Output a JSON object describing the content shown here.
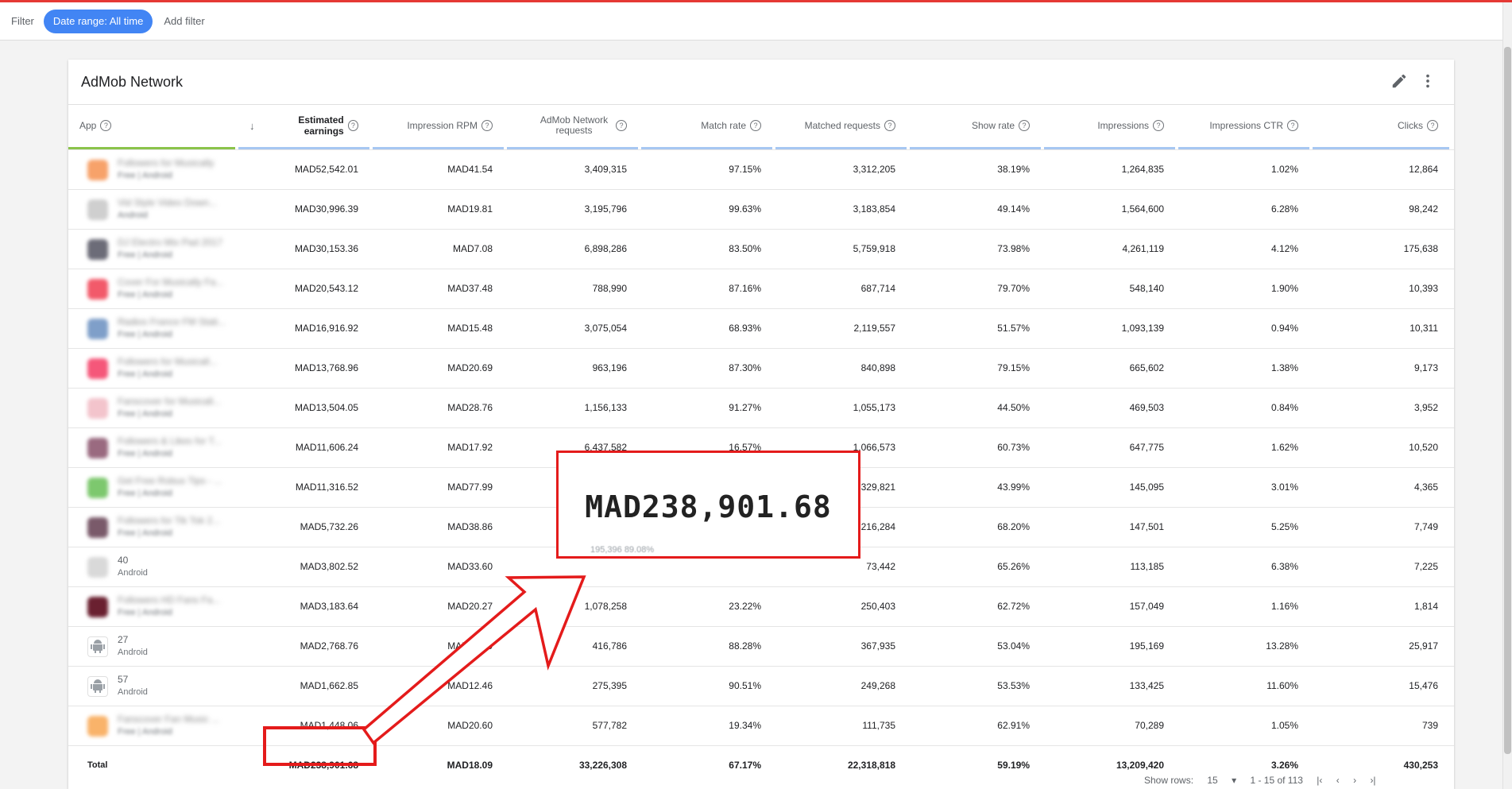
{
  "filterbar": {
    "filter_label": "Filter",
    "date_chip": "Date range: All time",
    "add_filter": "Add filter"
  },
  "card": {
    "title": "AdMob Network"
  },
  "columns": [
    {
      "label": "App",
      "help": true,
      "bold": false,
      "sorted": false
    },
    {
      "label": "Estimated earnings",
      "help": true,
      "bold": true,
      "sorted": true
    },
    {
      "label": "Impression RPM",
      "help": true,
      "bold": false,
      "sorted": false
    },
    {
      "label": "AdMob Network requests",
      "help": true,
      "bold": false,
      "sorted": false
    },
    {
      "label": "Match rate",
      "help": true,
      "bold": false,
      "sorted": false
    },
    {
      "label": "Matched requests",
      "help": true,
      "bold": false,
      "sorted": false
    },
    {
      "label": "Show rate",
      "help": true,
      "bold": false,
      "sorted": false
    },
    {
      "label": "Impressions",
      "help": true,
      "bold": false,
      "sorted": false
    },
    {
      "label": "Impressions CTR",
      "help": true,
      "bold": false,
      "sorted": false
    },
    {
      "label": "Clicks",
      "help": true,
      "bold": false,
      "sorted": false
    }
  ],
  "rows": [
    {
      "app_name": "Followers for Musically",
      "app_sub": "Free | Android",
      "blur": true,
      "icon_color": "#f7a26a",
      "android": false,
      "values": [
        "MAD52,542.01",
        "MAD41.54",
        "3,409,315",
        "97.15%",
        "3,312,205",
        "38.19%",
        "1,264,835",
        "1.02%",
        "12,864"
      ]
    },
    {
      "app_name": "Vid Style Video Down...",
      "app_sub": "Android",
      "blur": true,
      "icon_color": "#cfcfcf",
      "android": false,
      "values": [
        "MAD30,996.39",
        "MAD19.81",
        "3,195,796",
        "99.63%",
        "3,183,854",
        "49.14%",
        "1,564,600",
        "6.28%",
        "98,242"
      ]
    },
    {
      "app_name": "DJ Electro Mix Pad 2017",
      "app_sub": "Free | Android",
      "blur": true,
      "icon_color": "#6c6c78",
      "android": false,
      "values": [
        "MAD30,153.36",
        "MAD7.08",
        "6,898,286",
        "83.50%",
        "5,759,918",
        "73.98%",
        "4,261,119",
        "4.12%",
        "175,638"
      ]
    },
    {
      "app_name": "Cover For Musically Fa...",
      "app_sub": "Free | Android",
      "blur": true,
      "icon_color": "#f25a6a",
      "android": false,
      "values": [
        "MAD20,543.12",
        "MAD37.48",
        "788,990",
        "87.16%",
        "687,714",
        "79.70%",
        "548,140",
        "1.90%",
        "10,393"
      ]
    },
    {
      "app_name": "Radios France FM Stati...",
      "app_sub": "Free | Android",
      "blur": true,
      "icon_color": "#7f9fc9",
      "android": false,
      "values": [
        "MAD16,916.92",
        "MAD15.48",
        "3,075,054",
        "68.93%",
        "2,119,557",
        "51.57%",
        "1,093,139",
        "0.94%",
        "10,311"
      ]
    },
    {
      "app_name": "Followers for Musicall...",
      "app_sub": "Free | Android",
      "blur": true,
      "icon_color": "#f5577a",
      "android": false,
      "values": [
        "MAD13,768.96",
        "MAD20.69",
        "963,196",
        "87.30%",
        "840,898",
        "79.15%",
        "665,602",
        "1.38%",
        "9,173"
      ]
    },
    {
      "app_name": "Fanscover for Musicall...",
      "app_sub": "Free | Android",
      "blur": true,
      "icon_color": "#f3c4cc",
      "android": false,
      "values": [
        "MAD13,504.05",
        "MAD28.76",
        "1,156,133",
        "91.27%",
        "1,055,173",
        "44.50%",
        "469,503",
        "0.84%",
        "3,952"
      ]
    },
    {
      "app_name": "Followers & Likes for T...",
      "app_sub": "Free | Android",
      "blur": true,
      "icon_color": "#9a6a80",
      "android": false,
      "values": [
        "MAD11,606.24",
        "MAD17.92",
        "6,437,582",
        "16.57%",
        "1,066,573",
        "60.73%",
        "647,775",
        "1.62%",
        "10,520"
      ]
    },
    {
      "app_name": "Get Free Robux Tips - ...",
      "app_sub": "Free | Android",
      "blur": true,
      "icon_color": "#7dc86e",
      "android": false,
      "values": [
        "MAD11,316.52",
        "MAD77.99",
        "",
        "",
        "329,821",
        "43.99%",
        "145,095",
        "3.01%",
        "4,365"
      ]
    },
    {
      "app_name": "Followers for Tik Tok 2...",
      "app_sub": "Free | Android",
      "blur": true,
      "icon_color": "#7a5a6a",
      "android": false,
      "values": [
        "MAD5,732.26",
        "MAD38.86",
        "",
        "",
        "216,284",
        "68.20%",
        "147,501",
        "5.25%",
        "7,749"
      ]
    },
    {
      "app_name": "40",
      "app_sub": "Android",
      "blur": false,
      "icon_color": "#d9d9d9",
      "android": false,
      "values": [
        "MAD3,802.52",
        "MAD33.60",
        "",
        "",
        "73,442",
        "65.26%",
        "113,185",
        "6.38%",
        "7,225"
      ]
    },
    {
      "app_name": "Followers HD Fans Fa...",
      "app_sub": "Free | Android",
      "blur": true,
      "icon_color": "#6a2030",
      "android": false,
      "values": [
        "MAD3,183.64",
        "MAD20.27",
        "1,078,258",
        "23.22%",
        "250,403",
        "62.72%",
        "157,049",
        "1.16%",
        "1,814"
      ]
    },
    {
      "app_name": "27",
      "app_sub": "Android",
      "blur": false,
      "icon_color": "#ffffff",
      "android": true,
      "values": [
        "MAD2,768.76",
        "MAD14.19",
        "416,786",
        "88.28%",
        "367,935",
        "53.04%",
        "195,169",
        "13.28%",
        "25,917"
      ]
    },
    {
      "app_name": "57",
      "app_sub": "Android",
      "blur": false,
      "icon_color": "#ffffff",
      "android": true,
      "values": [
        "MAD1,662.85",
        "MAD12.46",
        "275,395",
        "90.51%",
        "249,268",
        "53.53%",
        "133,425",
        "11.60%",
        "15,476"
      ]
    },
    {
      "app_name": "Fanscover Fan Music ...",
      "app_sub": "Free | Android",
      "blur": true,
      "icon_color": "#f9b36a",
      "android": false,
      "values": [
        "MAD1,448.06",
        "MAD20.60",
        "577,782",
        "19.34%",
        "111,735",
        "62.91%",
        "70,289",
        "1.05%",
        "739"
      ]
    }
  ],
  "total": {
    "label": "Total",
    "values": [
      "MAD238,901.68",
      "MAD18.09",
      "33,226,308",
      "67.17%",
      "22,318,818",
      "59.19%",
      "13,209,420",
      "3.26%",
      "430,253"
    ]
  },
  "pagination": {
    "show_rows_label": "Show rows:",
    "rows_value": "15",
    "range": "1 - 15 of 113"
  },
  "callout": {
    "zoom_text": "MAD238,901.68",
    "zoom_ghost": "195,396          89.08%"
  },
  "colors": {
    "accent": "#4285f4",
    "header_underline": "#a7c7f2",
    "app_underline": "#8bc34a",
    "highlight": "#e41b1b",
    "top_line": "#e53935"
  }
}
